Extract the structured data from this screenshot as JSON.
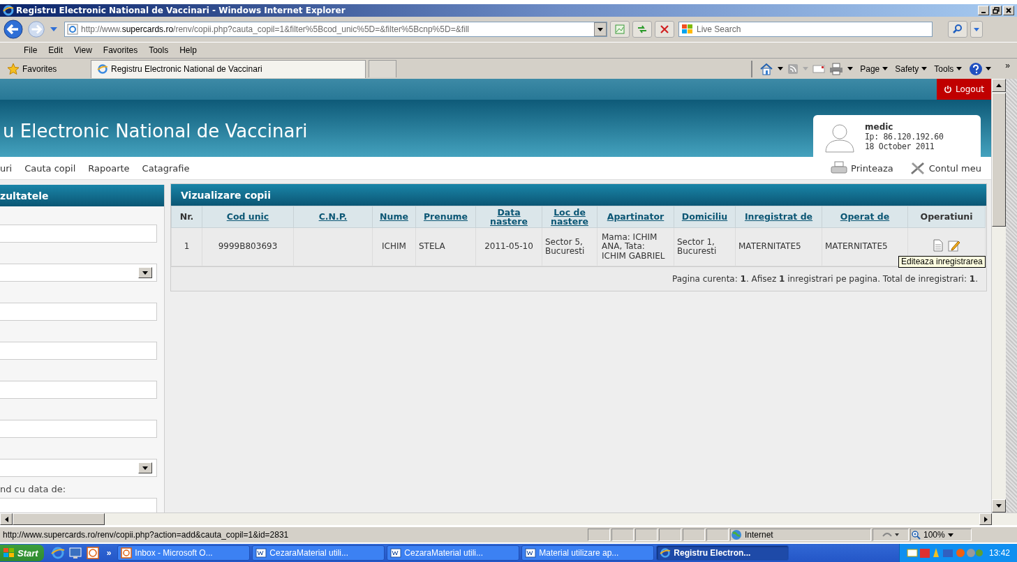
{
  "window": {
    "title": "Registru Electronic National de Vaccinari - Windows Internet Explorer"
  },
  "address_bar": {
    "prefix": "http://www.",
    "domain": "supercards.ro",
    "path": "/renv/copii.php?cauta_copil=1&filter%5Bcod_unic%5D=&filter%5Bcnp%5D=&fill"
  },
  "search": {
    "placeholder": "Live Search"
  },
  "menu": [
    "File",
    "Edit",
    "View",
    "Favorites",
    "Tools",
    "Help"
  ],
  "favorites_bar": {
    "favorites": "Favorites",
    "tab": "Registru Electronic National de Vaccinari",
    "commands": [
      "Page",
      "Safety",
      "Tools"
    ],
    "more": "»"
  },
  "page": {
    "logout": "Logout",
    "site_title": "u Electronic National de Vaccinari",
    "user": {
      "name": "medic",
      "ip": "Ip: 86.120.192.60",
      "date": "18 October 2011"
    },
    "nav": [
      "uri",
      "Cauta copil",
      "Rapoarte",
      "Catagrafie"
    ],
    "nav_right": [
      "Printeaza",
      "Contul meu"
    ],
    "filter_panel": {
      "title": "zultatele",
      "fields": [
        {
          "kind": "text"
        },
        {
          "kind": "select"
        },
        {
          "kind": "text"
        },
        {
          "kind": "text"
        },
        {
          "kind": "text"
        },
        {
          "kind": "text"
        },
        {
          "kind": "select"
        },
        {
          "kind": "text",
          "label": "nd cu data de:"
        }
      ]
    },
    "table": {
      "title": "Vizualizare copii",
      "columns": [
        {
          "label": "Nr.",
          "sortable": false
        },
        {
          "label": "Cod unic",
          "sortable": true
        },
        {
          "label": "C.N.P.",
          "sortable": true
        },
        {
          "label": "Nume",
          "sortable": true
        },
        {
          "label": "Prenume",
          "sortable": true
        },
        {
          "label": "Data nastere",
          "sortable": true
        },
        {
          "label": "Loc de nastere",
          "sortable": true
        },
        {
          "label": "Apartinator",
          "sortable": true
        },
        {
          "label": "Domiciliu",
          "sortable": true
        },
        {
          "label": "Inregistrat de",
          "sortable": true
        },
        {
          "label": "Operat de",
          "sortable": true
        },
        {
          "label": "Operatiuni",
          "sortable": false
        }
      ],
      "rows": [
        [
          "1",
          "9999B803693",
          "",
          "ICHIM",
          "STELA",
          "2011-05-10",
          "Sector 5, Bucuresti",
          "Mama: ICHIM ANA, Tata: ICHIM GABRIEL",
          "Sector 1, Bucuresti",
          "MATERNITATE5",
          "MATERNITATE5"
        ]
      ],
      "footer": "Pagina curenta: **1**. Afisez **1** inregistrari pe pagina. Total de inregistrari: **1**."
    },
    "tooltip": "Editeaza inregistrarea"
  },
  "status_bar": {
    "url": "http://www.supercards.ro/renv/copii.php?action=add&cauta_copil=1&id=2831",
    "zone": "Internet",
    "zoom": "100%"
  },
  "taskbar": {
    "start": "Start",
    "more": "»",
    "tasks": [
      {
        "label": "Inbox - Microsoft O...",
        "kind": "mail",
        "selected": false
      },
      {
        "label": "CezaraMaterial utili...",
        "kind": "doc",
        "selected": false
      },
      {
        "label": "CezaraMaterial utili...",
        "kind": "doc",
        "selected": false
      },
      {
        "label": "Material utilizare ap...",
        "kind": "doc",
        "selected": false
      },
      {
        "label": "Registru Electron...",
        "kind": "ie",
        "selected": true
      }
    ],
    "clock": "13:42"
  }
}
